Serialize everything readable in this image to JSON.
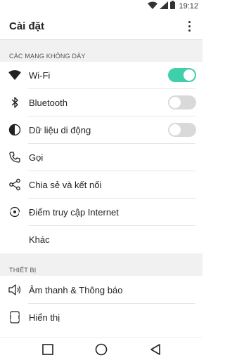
{
  "status_bar": {
    "time": "19:12",
    "icons": [
      "wifi-icon",
      "signal-icon",
      "battery-icon"
    ]
  },
  "app_bar": {
    "title": "Cài đặt",
    "menu_icon": "overflow-menu-icon"
  },
  "sections": [
    {
      "header": "CÁC MẠNG KHÔNG DÂY"
    },
    {
      "header": "THIẾT BỊ"
    }
  ],
  "wireless": {
    "wifi": {
      "label": "Wi-Fi",
      "toggle": "on"
    },
    "bluetooth": {
      "label": "Bluetooth",
      "toggle": "off"
    },
    "mobile_data": {
      "label": "Dữ liệu di động",
      "toggle": "off"
    },
    "call": {
      "label": "Gọi"
    },
    "share": {
      "label": "Chia sẻ và kết nối"
    },
    "hotspot": {
      "label": "Điểm truy cập Internet"
    },
    "more": {
      "label": "Khác"
    }
  },
  "device": {
    "sound": {
      "label": "Âm thanh & Thông báo"
    },
    "display": {
      "label": "Hiển thị"
    }
  },
  "colors": {
    "accent": "#3fcfa9",
    "toggle_off": "#d9d9d9",
    "section_bg": "#f1f1f1"
  },
  "nav": {
    "icons": [
      "recents-square-icon",
      "home-circle-icon",
      "back-triangle-icon"
    ]
  }
}
